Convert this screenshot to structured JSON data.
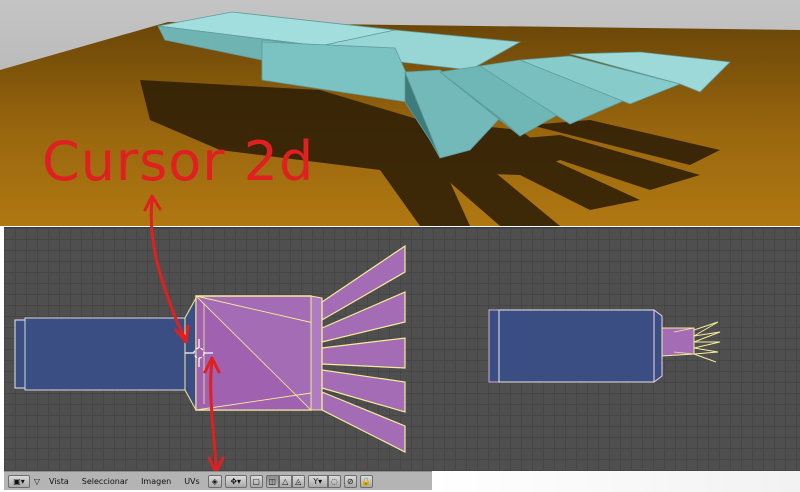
{
  "annotation": {
    "cursor_label": "Cursor 2d",
    "arrow_color": "#e02020"
  },
  "render_view": {
    "background_color": "#b6b6b6",
    "floor_color": "#8a5a0c",
    "model_color": "#7cc4c4"
  },
  "uv_editor": {
    "background_color": "#4f4f4f",
    "grid_color": "#464646",
    "selected_face_color": "#a46cb4",
    "unselected_face_color": "#3a4e84",
    "edge_color": "#f5ec9a"
  },
  "header": {
    "editor_type_icon": "uv-image-editor-icon",
    "menus": {
      "view": "Vista",
      "select": "Seleccionar",
      "image": "Imagen",
      "uvs": "UVs"
    },
    "pivot_icon": "cursor-2d-pivot-icon",
    "buttons": [
      "sync-selection-icon",
      "vertex-select-icon",
      "edge-select-icon",
      "face-select-icon",
      "island-select-icon",
      "sticky-mode-icon",
      "proportional-edit-icon",
      "snap-icon",
      "lock-icon"
    ]
  }
}
